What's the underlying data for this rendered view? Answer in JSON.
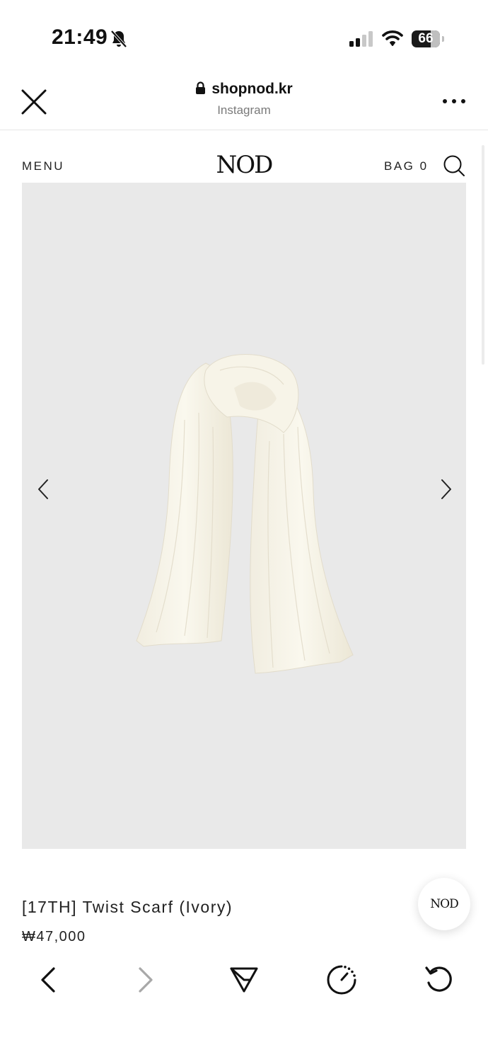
{
  "status_bar": {
    "time": "21:49",
    "battery": "66",
    "icons": [
      "bell-slash-icon",
      "cellular-signal-icon",
      "wifi-icon",
      "battery-icon"
    ]
  },
  "browser": {
    "domain": "shopnod.kr",
    "source": "Instagram",
    "icons": [
      "close-icon",
      "lock-icon",
      "more-icon"
    ]
  },
  "site": {
    "menu_label": "MENU",
    "logo": "NOD",
    "bag_label": "BAG 0",
    "icons": [
      "search-icon"
    ]
  },
  "product": {
    "name": "[17TH] Twist Scarf (Ivory)",
    "price": "₩47,000",
    "image_icons": [
      "chevron-left-icon",
      "chevron-right-icon"
    ]
  },
  "chat_button": {
    "label": "NOD"
  },
  "toolbar": {
    "items": [
      "back-icon",
      "forward-icon",
      "share-icon",
      "timer-icon",
      "reload-icon"
    ],
    "forward_enabled": false
  },
  "colors": {
    "background": "#ffffff",
    "image_background": "#e9e9e9",
    "text": "#222222",
    "muted": "#7a7a7a",
    "scarf": "#f6f3e6"
  }
}
